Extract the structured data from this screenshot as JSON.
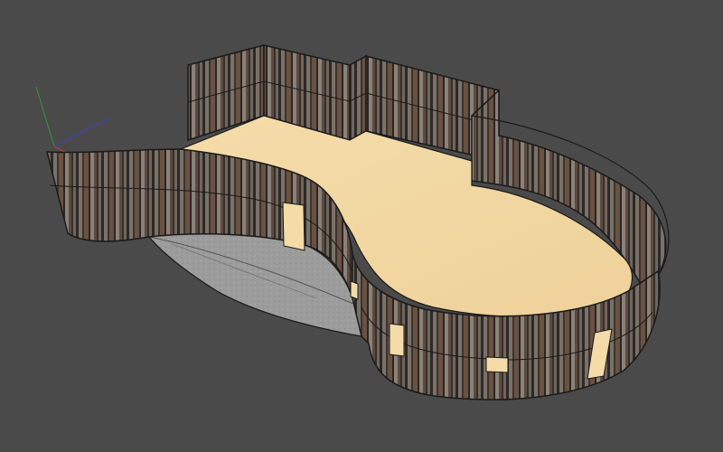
{
  "viewport": {
    "background": "#4a4a4a"
  },
  "axes": {
    "x_axis_color": "#4040c0",
    "y_axis_color": "#2e9a2e",
    "z_axis_color": "#c04040"
  },
  "model": {
    "floor_color": "#f2d9a6",
    "wall_texture": "weathered-wood-planks",
    "wall_outline_color": "#1a1a1a",
    "ramp_color": "#9a9a9a",
    "window_color": "#f4dba8"
  },
  "icons": [
    "axis-gizmo-icon"
  ]
}
